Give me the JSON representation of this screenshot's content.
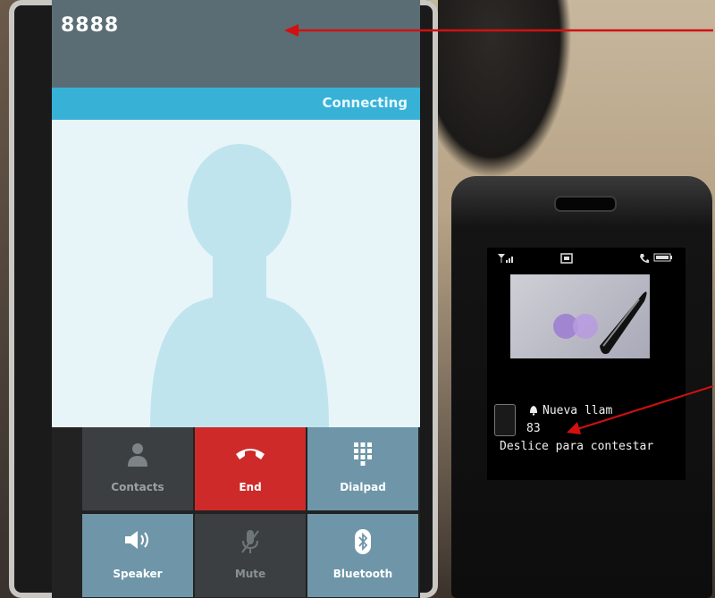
{
  "smartphone": {
    "caller_number": "8888",
    "call_status": "Connecting",
    "buttons": {
      "contacts": "Contacts",
      "end": "End",
      "dialpad": "Dialpad",
      "speaker": "Speaker",
      "mute": "Mute",
      "bluetooth": "Bluetooth"
    }
  },
  "feature_phone": {
    "incoming_title": "Nueva llam",
    "caller_number": "83",
    "slide_instruction": "Deslice para contestar"
  },
  "colors": {
    "end_red": "#cf2a2a",
    "status_cyan": "#37b2d6",
    "tile_blue": "#6e96a8",
    "arrow_red": "#d21010"
  }
}
